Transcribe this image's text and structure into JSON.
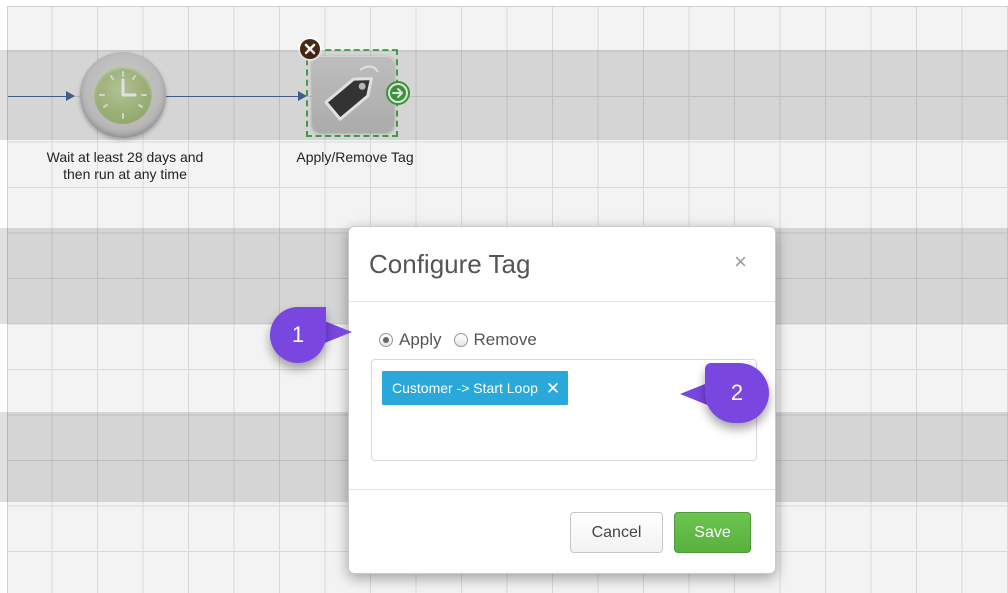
{
  "workflow": {
    "wait_node": {
      "label_line1": "Wait at least 28 days and",
      "label_line2": "then run at any time",
      "icon": "clock-icon"
    },
    "tag_node": {
      "label": "Apply/Remove Tag",
      "icon": "tag-icon",
      "delete_icon": "close-circle-icon",
      "run_icon": "arrow-right-circle-icon",
      "selected_border_color": "#4caf50"
    }
  },
  "modal": {
    "title": "Configure Tag",
    "close_glyph": "×",
    "options": [
      {
        "label": "Apply",
        "checked": true
      },
      {
        "label": "Remove",
        "checked": false
      }
    ],
    "tags": [
      {
        "label": "Customer -> Start Loop",
        "remove_glyph": "✕"
      }
    ],
    "buttons": {
      "cancel": "Cancel",
      "save": "Save"
    },
    "colors": {
      "chip": "#29a8d9",
      "save": "#5cb85c"
    }
  },
  "callouts": [
    {
      "number": "1"
    },
    {
      "number": "2"
    }
  ],
  "colors": {
    "callout": "#7a46e0",
    "connector": "#4a6a9a"
  }
}
